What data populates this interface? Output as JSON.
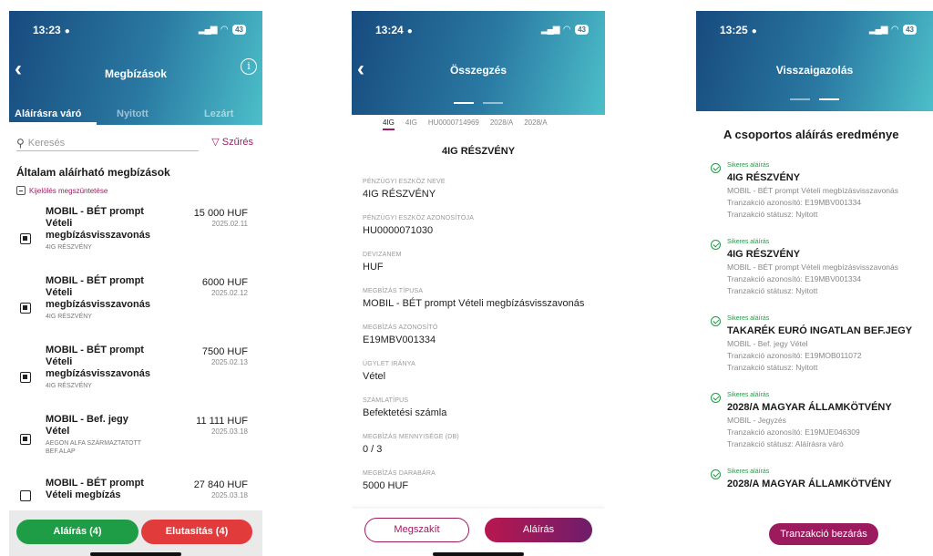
{
  "screen1": {
    "time": "13:23",
    "battery": "43",
    "title": "Megbízások",
    "tabs": [
      {
        "label": "Aláírásra váró"
      },
      {
        "label": "Nyitott"
      },
      {
        "label": "Lezárt"
      }
    ],
    "search_placeholder": "Keresés",
    "filter_label": "Szűrés",
    "section_title": "Általam aláírható megbízások",
    "deselect_label": "Kijelölés megszüntetése",
    "orders": [
      {
        "name": "MOBIL - BÉT prompt Vételi megbízásvisszavonás",
        "sub": "4IG RÉSZVÉNY",
        "amount": "15 000 HUF",
        "date": "2025.02.11",
        "checked": true
      },
      {
        "name": "MOBIL - BÉT prompt Vételi megbízásvisszavonás",
        "sub": "4IG RÉSZVÉNY",
        "amount": "6000 HUF",
        "date": "2025.02.12",
        "checked": true
      },
      {
        "name": "MOBIL - BÉT prompt Vételi megbízásvisszavonás",
        "sub": "4IG RÉSZVÉNY",
        "amount": "7500 HUF",
        "date": "2025.02.13",
        "checked": true
      },
      {
        "name": "MOBIL - Bef. jegy Vétel",
        "sub": "AEGON ALFA SZÁRMAZTATOTT BEF.ALAP",
        "amount": "11 111 HUF",
        "date": "2025.03.18",
        "checked": true
      },
      {
        "name": "MOBIL - BÉT prompt Vételi megbízás",
        "sub": "",
        "amount": "27 840 HUF",
        "date": "2025.03.18",
        "checked": false
      }
    ],
    "sign_button": "Aláírás (4)",
    "reject_button": "Elutasítás (4)"
  },
  "screen2": {
    "time": "13:24",
    "battery": "43",
    "title": "Összegzés",
    "subtabs": [
      "4IG",
      "4IG",
      "HU0000714969",
      "2028/A",
      "2028/A"
    ],
    "heading": "4IG RÉSZVÉNY",
    "fields": [
      {
        "label": "PÉNZÜGYI ESZKÖZ NEVE",
        "value": "4IG RÉSZVÉNY"
      },
      {
        "label": "PÉNZÜGYI ESZKÖZ AZONOSÍTÓJA",
        "value": "HU0000071030"
      },
      {
        "label": "DEVIZANEM",
        "value": "HUF"
      },
      {
        "label": "MEGBÍZÁS TÍPUSA",
        "value": "MOBIL - BÉT prompt Vételi megbízásvisszavonás"
      },
      {
        "label": "MEGBÍZÁS AZONOSÍTÓ",
        "value": "E19MBV001334"
      },
      {
        "label": "ÜGYLET IRÁNYA",
        "value": "Vétel"
      },
      {
        "label": "SZÁMLATÍPUS",
        "value": "Befektetési számla"
      },
      {
        "label": "MEGBÍZÁS MENNYISÉGE (DB)",
        "value": "0 / 3"
      },
      {
        "label": "MEGBÍZÁS DARABÁRA",
        "value": "5000 HUF"
      }
    ],
    "cancel_button": "Megszakít",
    "sign_button": "Aláírás"
  },
  "screen3": {
    "time": "13:25",
    "battery": "43",
    "title": "Visszaigazolás",
    "heading": "A csoportos aláírás eredménye",
    "results": [
      {
        "status": "Sikeres aláírás",
        "name": "4IG RÉSZVÉNY",
        "type": "MOBIL - BÉT prompt Vételi megbízásvisszavonás",
        "txid": "Tranzakció azonosító: E19MBV001334",
        "txstatus": "Tranzakció státusz: Nyitott"
      },
      {
        "status": "Sikeres aláírás",
        "name": "4IG RÉSZVÉNY",
        "type": "MOBIL - BÉT prompt Vételi megbízásvisszavonás",
        "txid": "Tranzakció azonosító: E19MBV001334",
        "txstatus": "Tranzakció státusz: Nyitott"
      },
      {
        "status": "Sikeres aláírás",
        "name": "TAKARÉK EURÓ INGATLAN BEF.JEGY",
        "type": "MOBIL - Bef. jegy Vétel",
        "txid": "Tranzakció azonosító: E19MOB011072",
        "txstatus": "Tranzakció státusz: Nyitott"
      },
      {
        "status": "Sikeres aláírás",
        "name": "2028/A MAGYAR ÁLLAMKÖTVÉNY",
        "type": "MOBIL - Jegyzés",
        "txid": "Tranzakció azonosító: E19MJE046309",
        "txstatus": "Tranzakció státusz: Aláírásra váró"
      },
      {
        "status": "Sikeres aláírás",
        "name": "2028/A MAGYAR ÁLLAMKÖTVÉNY",
        "type": "",
        "txid": "",
        "txstatus": ""
      }
    ],
    "close_button": "Tranzakció bezárás"
  }
}
